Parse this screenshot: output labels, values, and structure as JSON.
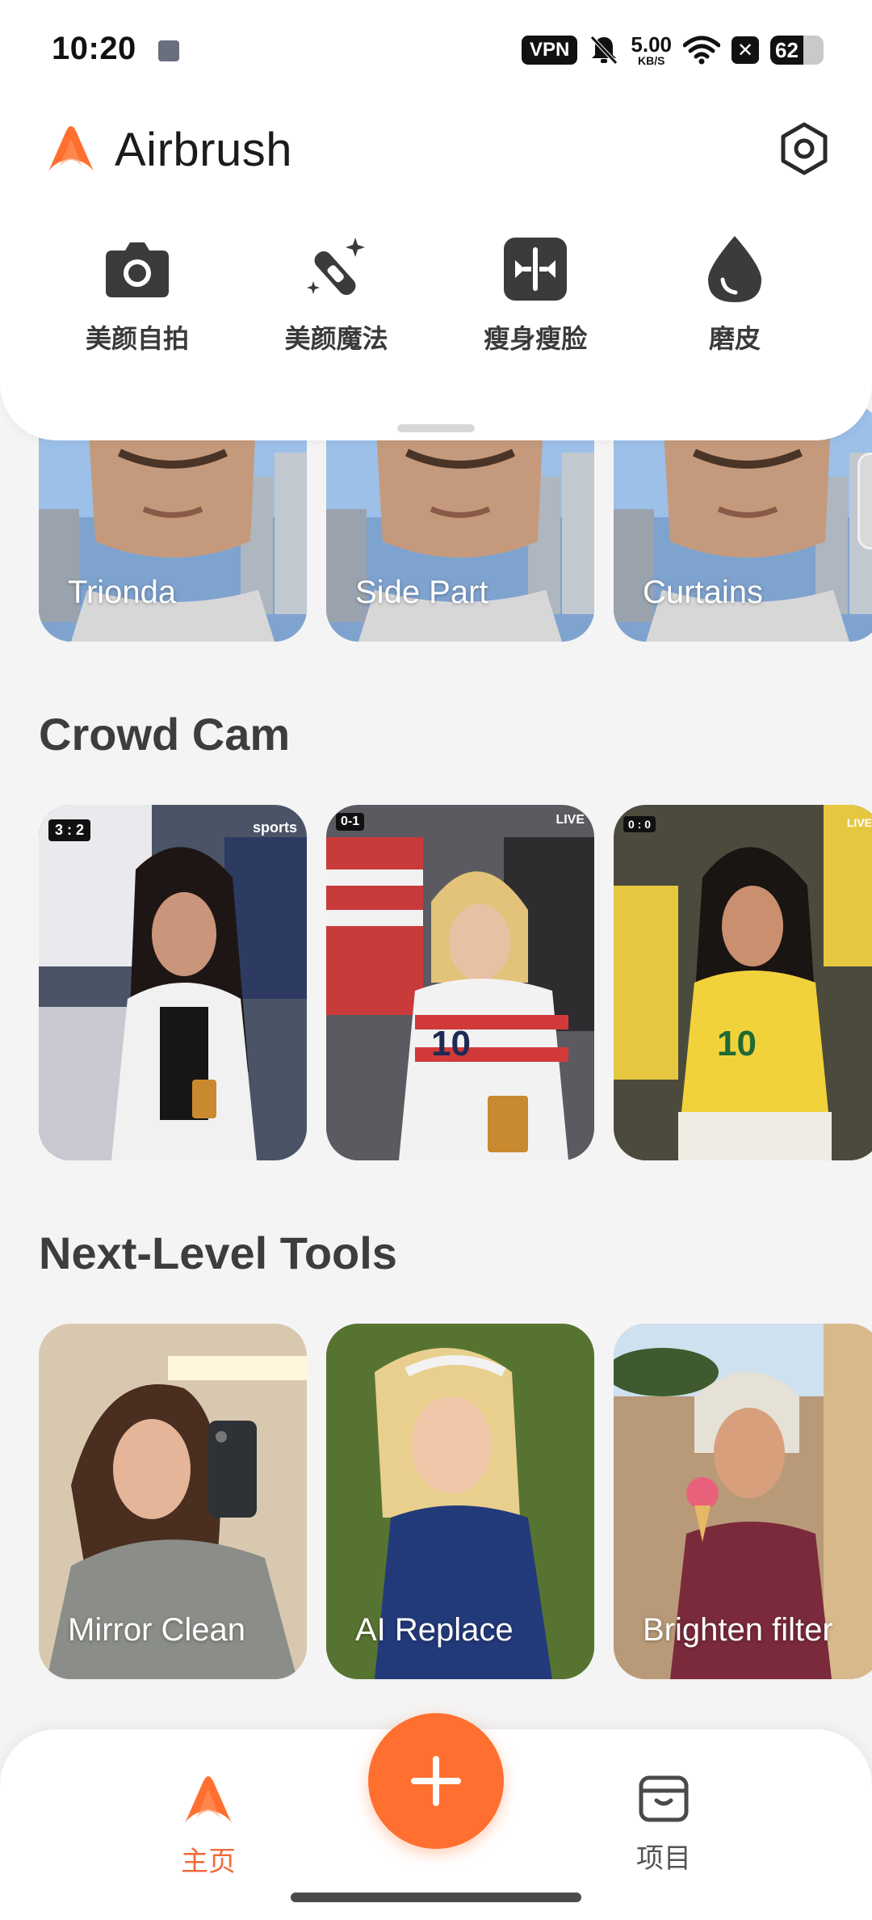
{
  "status_bar": {
    "time": "10:20",
    "vpn": "VPN",
    "net_speed_value": "5.00",
    "net_speed_unit": "KB/S",
    "battery": "62",
    "battery_level_percent": 62
  },
  "header": {
    "app_name": "Airbrush",
    "brand_color": "#ff6f2f"
  },
  "quick_tools": [
    {
      "label": "美颜自拍",
      "icon": "camera-icon"
    },
    {
      "label": "美颜魔法",
      "icon": "magic-wand-icon"
    },
    {
      "label": "瘦身瘦脸",
      "icon": "reshape-icon"
    },
    {
      "label": "磨皮",
      "icon": "drop-icon"
    }
  ],
  "hairstyle_cards": [
    {
      "label": "Trionda"
    },
    {
      "label": "Side Part"
    },
    {
      "label": "Curtains"
    }
  ],
  "sections": {
    "crowd_cam": {
      "title": "Crowd Cam",
      "cards": [
        {
          "score": "3 : 2",
          "badge": "sports"
        },
        {
          "score": "0-1",
          "badge": "LIVE"
        },
        {
          "score": "0 : 0",
          "badge": "LIVE"
        }
      ]
    },
    "next_level_tools": {
      "title": "Next-Level Tools",
      "cards": [
        {
          "label": "Mirror Clean"
        },
        {
          "label": "AI Replace"
        },
        {
          "label": "Brighten filter"
        }
      ]
    }
  },
  "bottom_nav": {
    "home_label": "主页",
    "projects_label": "项目",
    "active": "home"
  }
}
